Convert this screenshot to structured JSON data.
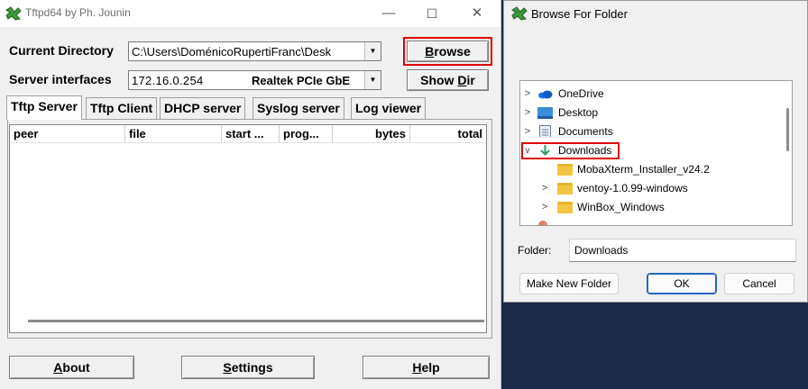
{
  "tftp": {
    "title": "Tftpd64 by Ph. Jounin",
    "window_controls": {
      "minimize": "—",
      "maximize": "☐",
      "close": "✕"
    },
    "current_directory": {
      "label": "Current Directory",
      "value": "C:\\Users\\DoménicoRupertiFranc\\Desk"
    },
    "server_interfaces": {
      "label": "Server interfaces",
      "ip": "172.16.0.254",
      "adapter": "Realtek PCIe GbE"
    },
    "browse_button": {
      "accel": "B",
      "rest": "rowse"
    },
    "show_dir_button": {
      "pre": "Show ",
      "accel": "D",
      "rest": "ir"
    },
    "tabs": [
      "Tftp Server",
      "Tftp Client",
      "DHCP server",
      "Syslog server",
      "Log viewer"
    ],
    "columns": [
      "peer",
      "file",
      "start ...",
      "prog...",
      "bytes",
      "total"
    ],
    "bottom_buttons": {
      "about": {
        "accel": "A",
        "rest": "bout"
      },
      "settings": {
        "accel": "S",
        "rest": "ettings"
      },
      "help": {
        "accel": "H",
        "rest": "elp"
      }
    },
    "highlight_color": "#e00000"
  },
  "browse": {
    "title": "Browse For Folder",
    "tree": [
      {
        "label": "OneDrive",
        "chevron": ">",
        "icon": "cloud-icon"
      },
      {
        "label": "Desktop",
        "chevron": ">",
        "icon": "desktop-icon"
      },
      {
        "label": "Documents",
        "chevron": ">",
        "icon": "documents-icon"
      },
      {
        "label": "Downloads",
        "chevron": "v",
        "icon": "download-arrow-icon",
        "selected": true
      },
      {
        "label": "MobaXterm_Installer_v24.2",
        "chevron": "",
        "icon": "folder-icon"
      },
      {
        "label": "ventoy-1.0.99-windows",
        "chevron": ">",
        "icon": "folder-icon"
      },
      {
        "label": "WinBox_Windows",
        "chevron": ">",
        "icon": "folder-icon"
      }
    ],
    "folder_label": "Folder:",
    "folder_value": "Downloads",
    "make_new_folder": "Make New Folder",
    "ok": "OK",
    "cancel": "Cancel"
  }
}
